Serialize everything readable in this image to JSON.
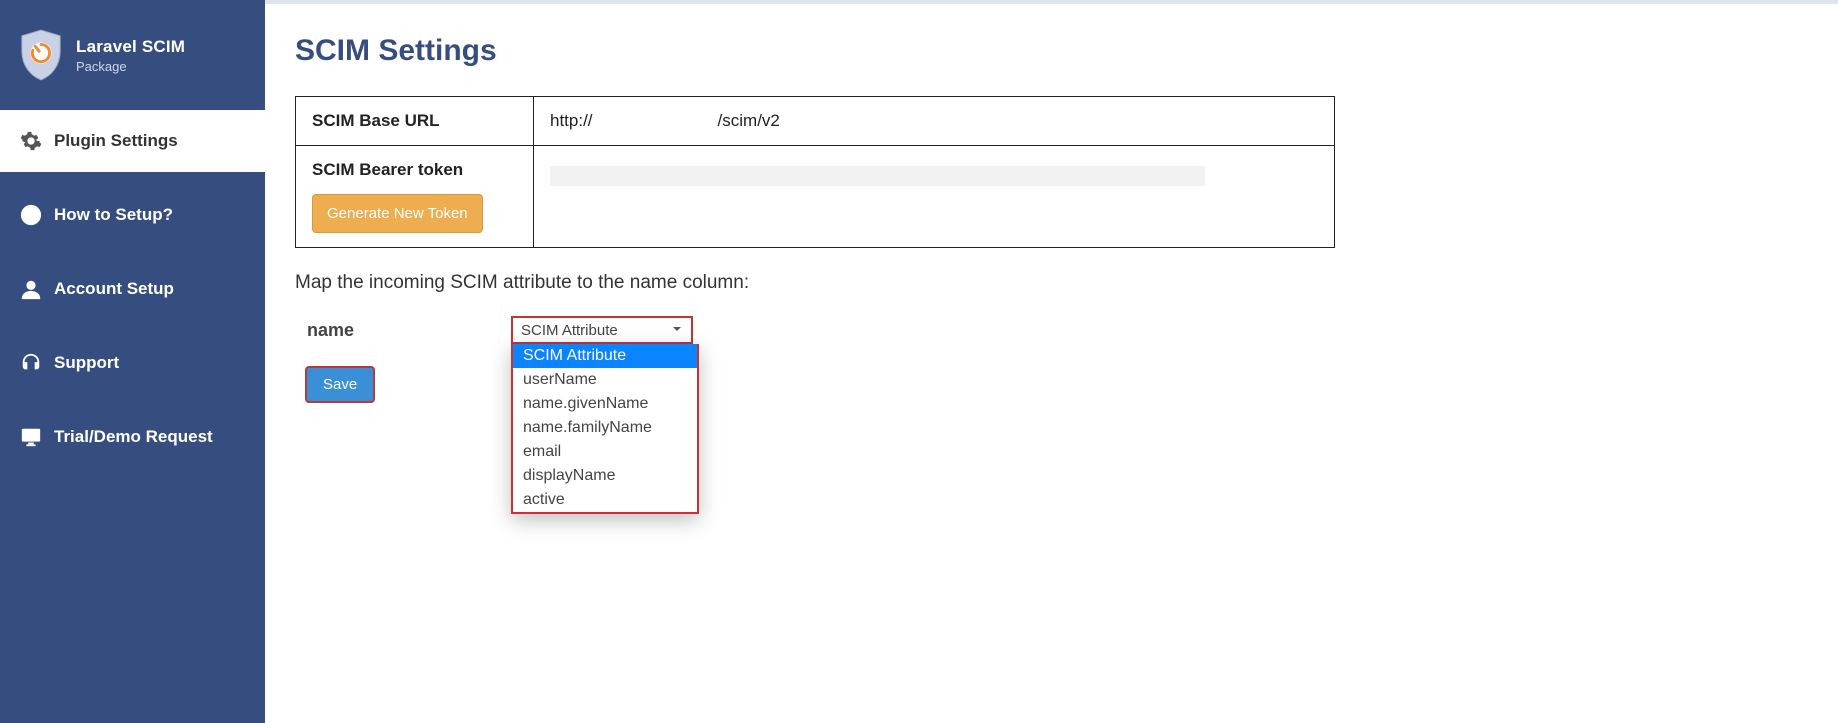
{
  "brand": {
    "title": "Laravel SCIM",
    "subtitle": "Package"
  },
  "sidebar": {
    "items": [
      {
        "icon": "gear-icon",
        "label": "Plugin Settings",
        "active": true
      },
      {
        "icon": "info-icon",
        "label": "How to Setup?",
        "active": false
      },
      {
        "icon": "user-icon",
        "label": "Account Setup",
        "active": false
      },
      {
        "icon": "headset-icon",
        "label": "Support",
        "active": false
      },
      {
        "icon": "monitor-icon",
        "label": "Trial/Demo Request",
        "active": false
      }
    ]
  },
  "main": {
    "title": "SCIM Settings",
    "table": {
      "base_url_label": "SCIM Base URL",
      "base_url_prefix": "http://",
      "base_url_suffix": "/scim/v2",
      "bearer_label": "SCIM Bearer token",
      "generate_btn": "Generate New Token"
    },
    "map_label": "Map the incoming SCIM attribute to the name column:",
    "map_field": "name",
    "select": {
      "selected": "SCIM Attribute",
      "options": [
        "SCIM Attribute",
        "userName",
        "name.givenName",
        "name.familyName",
        "email",
        "displayName",
        "active"
      ]
    },
    "save_btn": "Save"
  }
}
